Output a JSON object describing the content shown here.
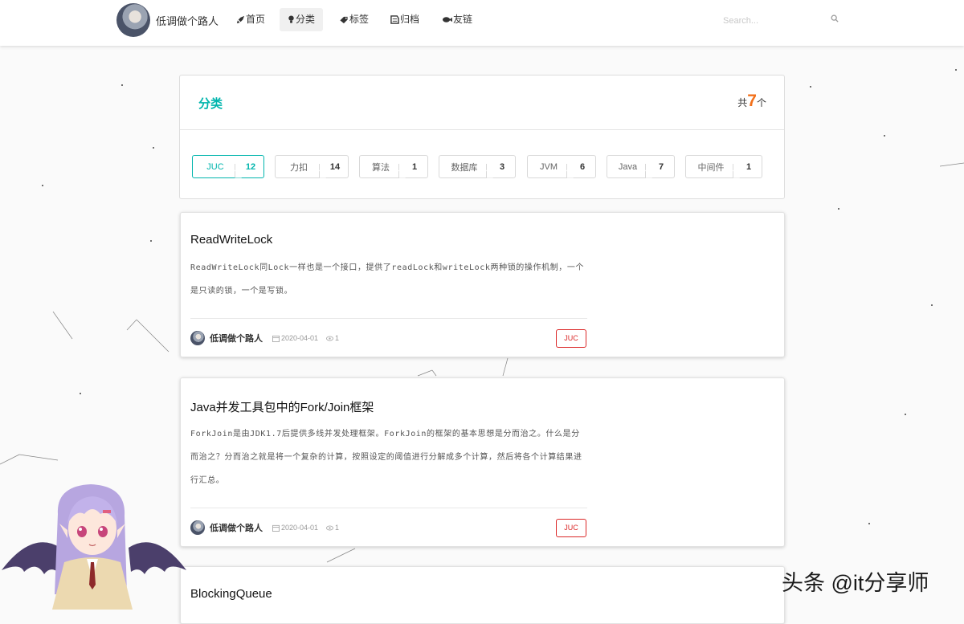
{
  "navbar": {
    "brand_name": "低调做个路人",
    "items": [
      {
        "label": "首页",
        "icon": "rocket-icon"
      },
      {
        "label": "分类",
        "icon": "lightbulb-icon",
        "active": true
      },
      {
        "label": "标签",
        "icon": "tag-icon"
      },
      {
        "label": "归档",
        "icon": "archive-icon"
      },
      {
        "label": "友链",
        "icon": "fish-icon"
      }
    ],
    "search_placeholder": "Search..."
  },
  "categories": {
    "title": "分类",
    "count_prefix": "共",
    "count": "7",
    "count_suffix": "个",
    "tags": [
      {
        "name": "JUC",
        "count": "12",
        "active": true
      },
      {
        "name": "力扣",
        "count": "14"
      },
      {
        "name": "算法",
        "count": "1"
      },
      {
        "name": "数据库",
        "count": "3"
      },
      {
        "name": "JVM",
        "count": "6"
      },
      {
        "name": "Java",
        "count": "7"
      },
      {
        "name": "中间件",
        "count": "1"
      }
    ]
  },
  "articles": [
    {
      "title": "ReadWriteLock",
      "summary": "ReadWriteLock同Lock一样也是一个接口，提供了readLock和writeLock两种锁的操作机制，一个是只读的锁，一个是写锁。",
      "author": "低调做个路人",
      "date": "2020-04-01",
      "views": "1",
      "tag": "JUC"
    },
    {
      "title": "Java并发工具包中的Fork/Join框架",
      "summary": "ForkJoin是由JDK1.7后提供多线并发处理框架。ForkJoin的框架的基本思想是分而治之。什么是分而治之？分而治之就是将一个复杂的计算，按照设定的阈值进行分解成多个计算，然后将各个计算结果进行汇总。",
      "author": "低调做个路人",
      "date": "2020-04-01",
      "views": "1",
      "tag": "JUC"
    },
    {
      "title": "BlockingQueue"
    }
  ],
  "watermark": "头条 @it分享师",
  "colors": {
    "accent": "#00b5ad",
    "count": "#f2711c",
    "tag_red": "#db2828"
  }
}
